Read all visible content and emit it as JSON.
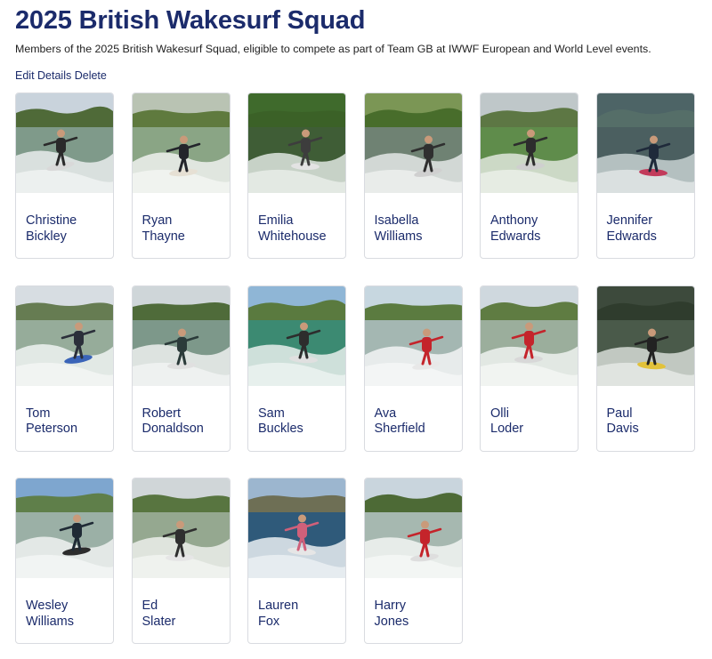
{
  "page": {
    "title": "2025 British Wakesurf Squad",
    "description": "Members of the 2025 British Wakesurf Squad, eligible to compete as part of Team GB at IWWF European and World Level events.",
    "actions": {
      "edit_label": "Edit Details",
      "delete_label": "Delete"
    }
  },
  "members": [
    {
      "first": "Christine",
      "last": "Bickley",
      "photo": {
        "sky": "#c9d3dc",
        "trees": "#4f6a38",
        "water": "#7f9a8a",
        "wake": "#e9ecec",
        "suit": "#2a2a2a",
        "board": "#d9d9d9"
      }
    },
    {
      "first": "Ryan",
      "last": "Thayne",
      "photo": {
        "sky": "#b9c3b3",
        "trees": "#5f7a3e",
        "water": "#8aa585",
        "wake": "#eef1ee",
        "suit": "#23252b",
        "board": "#e6e0d4"
      }
    },
    {
      "first": "Emilia",
      "last": "Whitehouse",
      "photo": {
        "sky": "#3f6a2c",
        "trees": "#3b6127",
        "water": "#3f5d36",
        "wake": "#dfe6e0",
        "suit": "#3d3d3d",
        "board": "#e3e3e3"
      }
    },
    {
      "first": "Isabella",
      "last": "Williams",
      "photo": {
        "sky": "#7b9655",
        "trees": "#486d2b",
        "water": "#6f8273",
        "wake": "#e4e8e6",
        "suit": "#2f2f2f",
        "board": "#d0d0d0"
      }
    },
    {
      "first": "Anthony",
      "last": "Edwards",
      "photo": {
        "sky": "#bfc7c9",
        "trees": "#5d7744",
        "water": "#5f8c4b",
        "wake": "#dfe6dc",
        "suit": "#2d2d2d",
        "board": "#cfcfcf"
      }
    },
    {
      "first": "Jennifer",
      "last": "Edwards",
      "photo": {
        "sky": "#4d6466",
        "trees": "#556e68",
        "water": "#4b5f60",
        "wake": "#c7d1d1",
        "suit": "#1f2a3a",
        "board": "#c23b5b"
      }
    },
    {
      "first": "Tom",
      "last": "Peterson",
      "photo": {
        "sky": "#d7dde2",
        "trees": "#667c52",
        "water": "#96ac9a",
        "wake": "#f0f3f2",
        "suit": "#2b2f3a",
        "board": "#3a64b8"
      }
    },
    {
      "first": "Robert",
      "last": "Donaldson",
      "photo": {
        "sky": "#cfd6d9",
        "trees": "#4f6b3a",
        "water": "#7d988a",
        "wake": "#edf0ef",
        "suit": "#2b3b3a",
        "board": "#e0e0e0"
      }
    },
    {
      "first": "Sam",
      "last": "Buckles",
      "photo": {
        "sky": "#8fb6d6",
        "trees": "#5a7a3f",
        "water": "#3c8a72",
        "wake": "#e7efec",
        "suit": "#2d2d2d",
        "board": "#e0e0e0"
      }
    },
    {
      "first": "Ava",
      "last": "Sherfield",
      "photo": {
        "sky": "#c7d7e0",
        "trees": "#5b7b40",
        "water": "#a4b7b2",
        "wake": "#f3f5f5",
        "suit": "#c4242b",
        "board": "#e8e8e8"
      }
    },
    {
      "first": "Olli",
      "last": "Loder",
      "photo": {
        "sky": "#cfd8de",
        "trees": "#5f7c42",
        "water": "#9bae9c",
        "wake": "#eff2f0",
        "suit": "#c4242b",
        "board": "#d8d8d8"
      }
    },
    {
      "first": "Paul",
      "last": "Davis",
      "photo": {
        "sky": "#3d4a3c",
        "trees": "#2f3c2d",
        "water": "#4a5a4a",
        "wake": "#d6dcd6",
        "suit": "#222222",
        "board": "#e2c23a"
      }
    },
    {
      "first": "Wesley",
      "last": "Williams",
      "photo": {
        "sky": "#7ea6cf",
        "trees": "#5f7f4a",
        "water": "#9bb0a6",
        "wake": "#f0f2f1",
        "suit": "#1f2a35",
        "board": "#2c2c2c"
      }
    },
    {
      "first": "Ed",
      "last": "Slater",
      "photo": {
        "sky": "#d0d6d8",
        "trees": "#587540",
        "water": "#95a890",
        "wake": "#eceeeb",
        "suit": "#2f2f2f",
        "board": "#e6e6e6"
      }
    },
    {
      "first": "Lauren",
      "last": "Fox",
      "photo": {
        "sky": "#9cb6cf",
        "trees": "#6e6f55",
        "water": "#2f5a7a",
        "wake": "#e9eef2",
        "suit": "#d0607a",
        "board": "#e6e6e6"
      }
    },
    {
      "first": "Harry",
      "last": "Jones",
      "photo": {
        "sky": "#c9d5dd",
        "trees": "#4d6a36",
        "water": "#a6b8b0",
        "wake": "#f2f4f3",
        "suit": "#c4242b",
        "board": "#dedede"
      }
    }
  ]
}
